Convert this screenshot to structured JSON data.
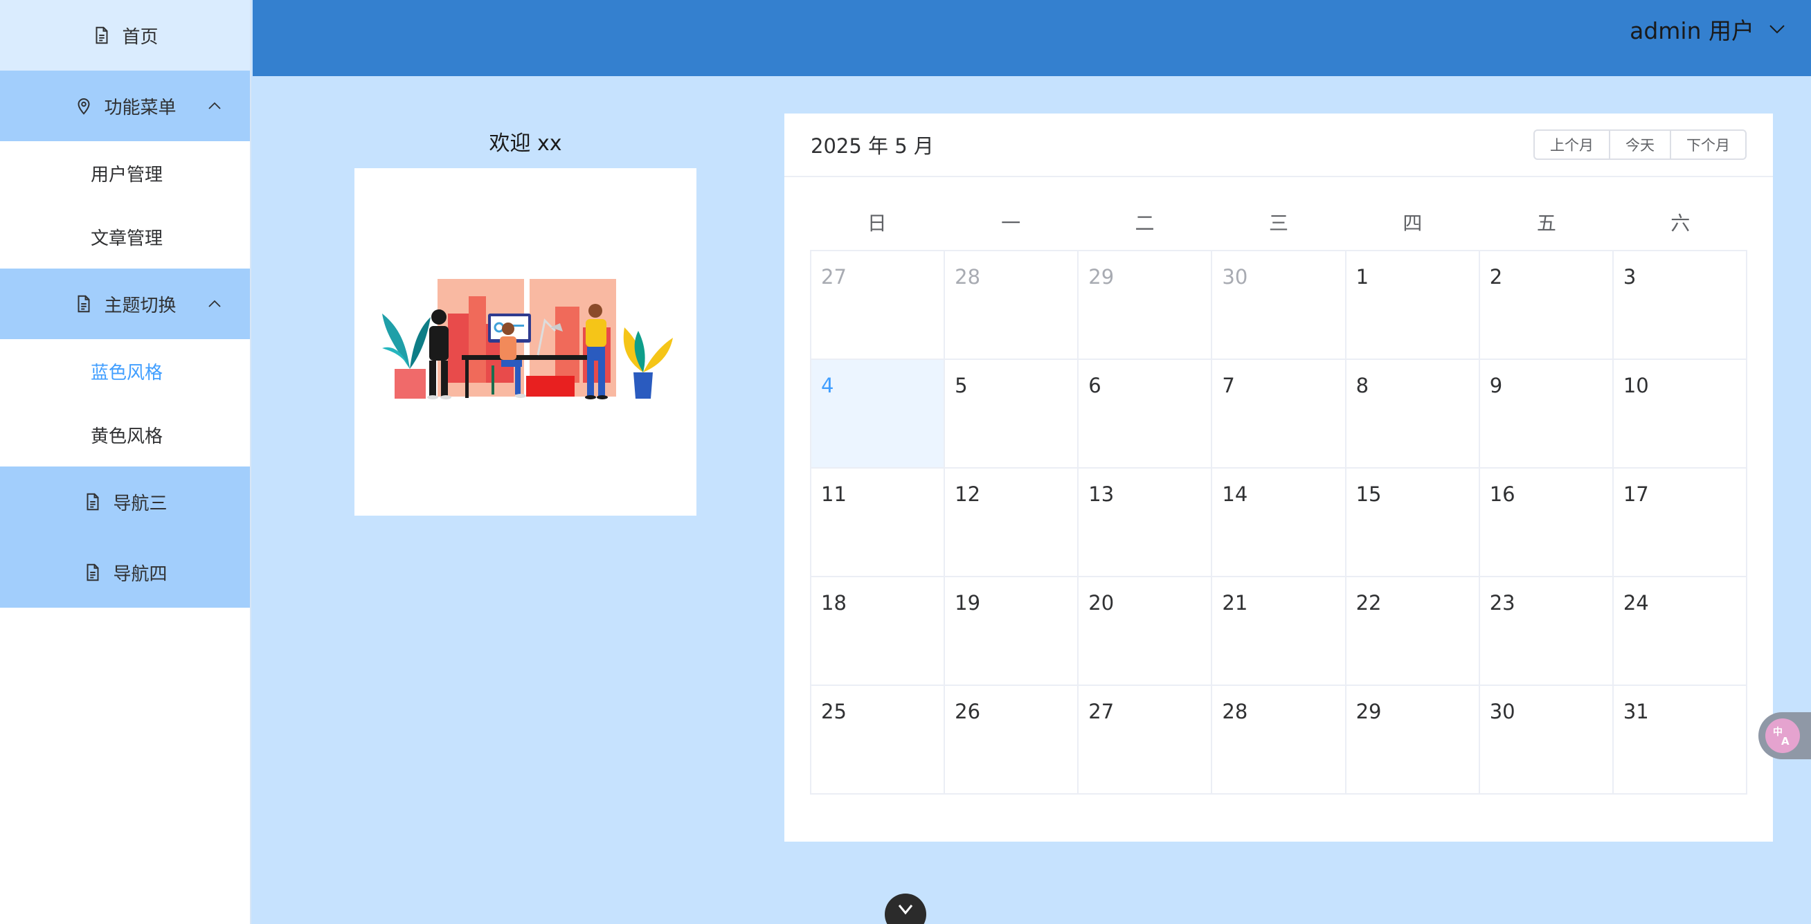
{
  "sidebar": {
    "home_label": "首页",
    "feature_menu": {
      "label": "功能菜单",
      "items": [
        "用户管理",
        "文章管理"
      ]
    },
    "theme_menu": {
      "label": "主题切换",
      "items": [
        "蓝色风格",
        "黄色风格"
      ],
      "active": "蓝色风格"
    },
    "nav3_label": "导航三",
    "nav4_label": "导航四"
  },
  "header": {
    "user_label": "admin 用户"
  },
  "welcome": {
    "title": "欢迎 xx"
  },
  "calendar": {
    "title": "2025 年 5 月",
    "buttons": {
      "prev": "上个月",
      "today": "今天",
      "next": "下个月"
    },
    "weekdays": [
      "日",
      "一",
      "二",
      "三",
      "四",
      "五",
      "六"
    ],
    "weeks": [
      [
        "27",
        "28",
        "29",
        "30",
        "1",
        "2",
        "3"
      ],
      [
        "4",
        "5",
        "6",
        "7",
        "8",
        "9",
        "10"
      ],
      [
        "11",
        "12",
        "13",
        "14",
        "15",
        "16",
        "17"
      ],
      [
        "18",
        "19",
        "20",
        "21",
        "22",
        "23",
        "24"
      ],
      [
        "25",
        "26",
        "27",
        "28",
        "29",
        "30",
        "31"
      ]
    ],
    "today": "4"
  },
  "colors": {
    "header": "#3480cf",
    "background": "#c6e2fe",
    "menu_group": "#a2cefc",
    "accent": "#409eff"
  },
  "widgets": {
    "translate_icon": "translate-icon",
    "scroll_icon": "chevron-down-icon"
  }
}
